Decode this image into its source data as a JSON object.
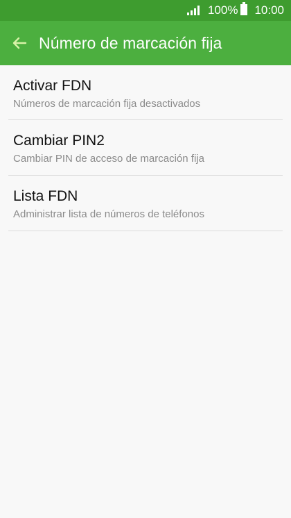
{
  "status_bar": {
    "battery_percent": "100%",
    "time": "10:00",
    "signal_level": 4,
    "icons": [
      "signal-icon",
      "battery-icon"
    ]
  },
  "app_bar": {
    "title": "Número de marcación fija",
    "back_icon": "arrow-left-icon"
  },
  "settings_list": [
    {
      "title": "Activar FDN",
      "subtitle": "Números de marcación fija desactivados"
    },
    {
      "title": "Cambiar PIN2",
      "subtitle": "Cambiar PIN de acceso de marcación fija"
    },
    {
      "title": "Lista FDN",
      "subtitle": "Administrar lista de números de teléfonos"
    }
  ],
  "colors": {
    "status_bar": "#3e9c2f",
    "app_bar": "#4caf3f",
    "background": "#f8f8f8",
    "divider": "#dcdcdc",
    "back_arrow": "#d8f2a8"
  }
}
